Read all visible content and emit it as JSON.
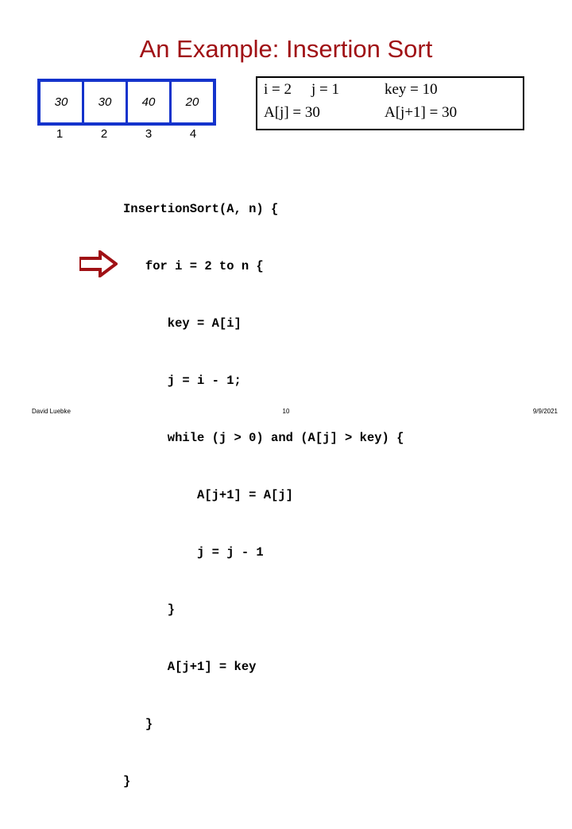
{
  "slide": {
    "title": "An Example: Insertion Sort",
    "title_color": "#a01115",
    "background": "#ffffff"
  },
  "array": {
    "border_color": "#1433cc",
    "values": [
      "30",
      "30",
      "40",
      "20"
    ],
    "indices": [
      "1",
      "2",
      "3",
      "4"
    ]
  },
  "state": {
    "border_color": "#000000",
    "line1": {
      "i": "i = 2",
      "j": "j = 1",
      "key": "key = 10"
    },
    "line2": {
      "aj": "A[j] = 30",
      "ajp1": "A[j+1] = 30"
    }
  },
  "pointer": {
    "icon": "right-arrow-icon",
    "color": "#a01115"
  },
  "code": {
    "lines": [
      "InsertionSort(A, n) {",
      "   for i = 2 to n {",
      "      key = A[i]",
      "      j = i - 1;",
      "      while (j > 0) and (A[j] > key) {",
      "          A[j+1] = A[j]",
      "          j = j - 1",
      "      }",
      "      A[j+1] = key",
      "   }",
      "}"
    ]
  },
  "footer": {
    "author": "David Luebke",
    "page": "10",
    "date": "9/9/2021"
  }
}
